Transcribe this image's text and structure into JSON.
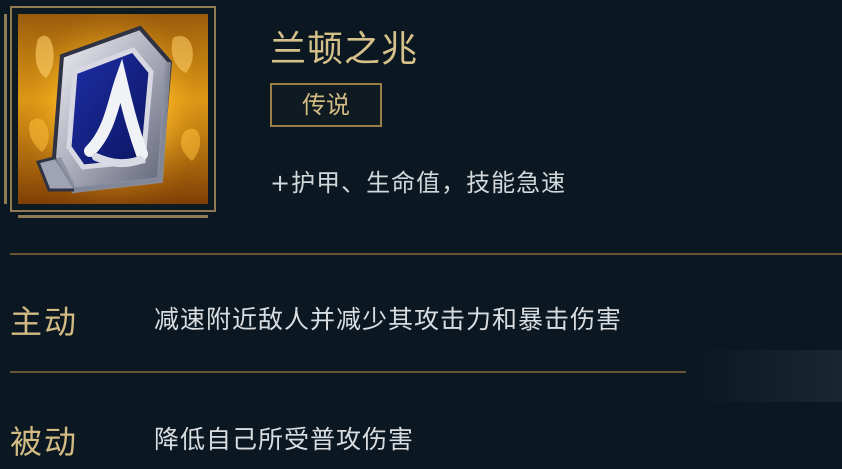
{
  "item": {
    "name": "兰顿之兆",
    "rarity": "传说",
    "stats": "+护甲、生命值，技能急速",
    "icon": "shield-icon"
  },
  "abilities": {
    "active": {
      "label": "主动",
      "description": "减速附近敌人并减少其攻击力和暴击伤害"
    },
    "passive": {
      "label": "被动",
      "description": "降低自己所受普攻伤害"
    }
  },
  "colors": {
    "background": "#0b1822",
    "gold": "#d2bb83",
    "gold_dark": "#8f7a54",
    "text": "#d9dde0"
  }
}
